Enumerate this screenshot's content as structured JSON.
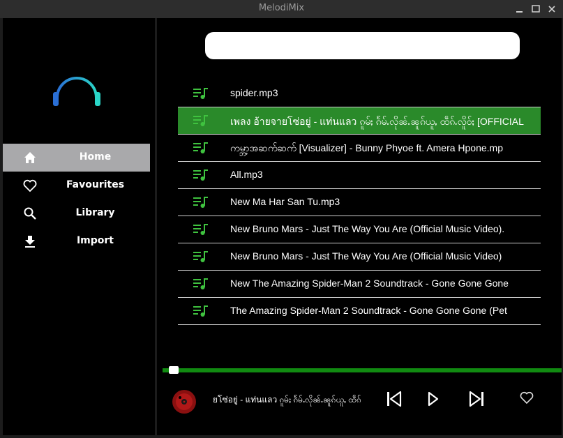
{
  "window": {
    "title": "MelodiMix"
  },
  "colors": {
    "accent": "#118a11",
    "selected_row": "#2a8a2a",
    "nav_active": "#a9a9ab"
  },
  "sidebar": {
    "items": [
      {
        "label": "Home",
        "icon": "home-icon"
      },
      {
        "label": "Favourites",
        "icon": "heart-outline-icon"
      },
      {
        "label": "Library",
        "icon": "search-icon"
      },
      {
        "label": "Import",
        "icon": "download-icon"
      }
    ]
  },
  "search": {
    "value": "",
    "placeholder": ""
  },
  "songs": [
    {
      "name": "spider.mp3",
      "icon": "queue-music-icon"
    },
    {
      "name": "เพลง อ้ายจายโซ่อยู่ - แท่นแลว ၵူမ်ႈ ၵႅမ်ႉလိုၼ်ႉၼူၵ်ယူႇ ထဵၵ်ႉလိူဝ်ႈ [OFFICIAL",
      "icon": "queue-music-icon"
    },
    {
      "name": "ကမ္ဘာ့အဆက်ဆက် [Visualizer] - Bunny Phyoe ft. Amera Hpone.mp",
      "icon": "queue-music-icon"
    },
    {
      "name": "All.mp3",
      "icon": "queue-music-icon"
    },
    {
      "name": "New Ma Har San Tu.mp3",
      "icon": "queue-music-icon"
    },
    {
      "name": "New Bruno Mars - Just The Way You Are (Official Music Video).",
      "icon": "queue-music-icon"
    },
    {
      "name": "New Bruno Mars - Just The Way You Are (Official Music Video)",
      "icon": "queue-music-icon"
    },
    {
      "name": "New The Amazing Spider-Man 2 Soundtrack  - Gone Gone Gone",
      "icon": "queue-music-icon"
    },
    {
      "name": "The Amazing Spider-Man 2 Soundtrack  - Gone Gone Gone (Pet",
      "icon": "queue-music-icon"
    }
  ],
  "selected_index": 1,
  "player": {
    "now_playing": "ยโซ่อยู่ - แท่นแลว ၵူမ်ႈ ၵႅမ်ႉလိုၼ်ႉၼူၵ်ယူႇ ထဵၵ်",
    "progress": 0.02
  }
}
